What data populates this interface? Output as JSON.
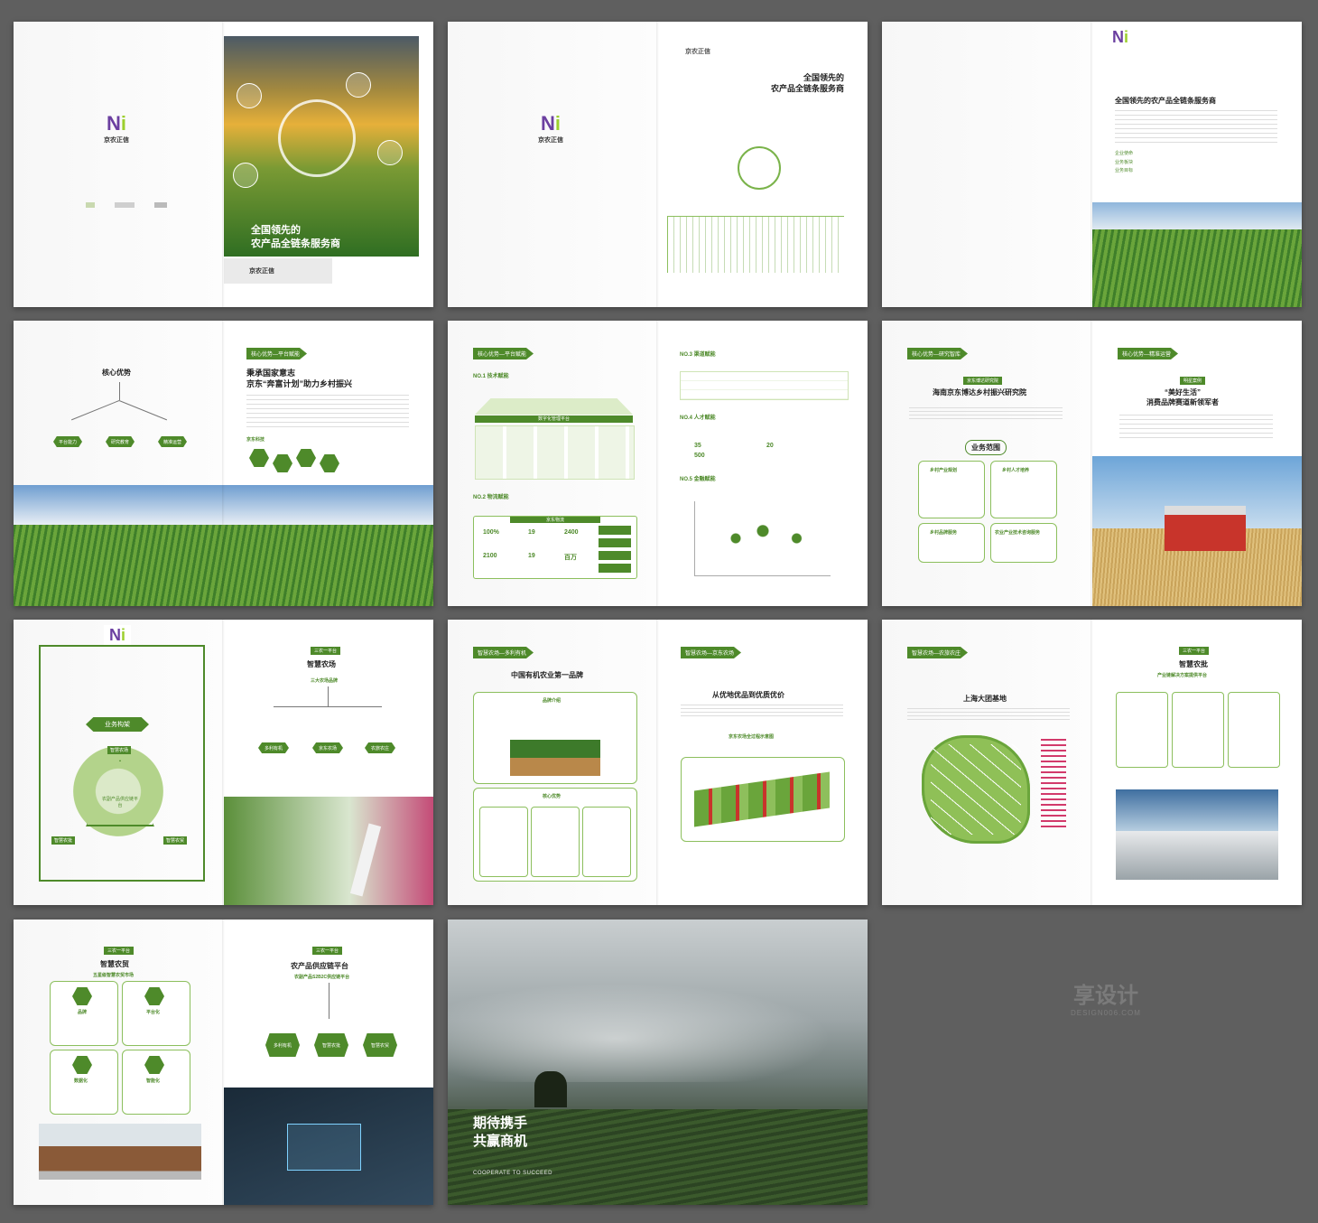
{
  "brand": {
    "name": "京农正信",
    "accent": "#4e8a2a",
    "accent_light": "#9ccf2e",
    "logo_purple": "#6b3fa0"
  },
  "spread1": {
    "cover_title_1": "全国领先的",
    "cover_title_2": "农产品全链条服务商",
    "brand_name": "京农正信"
  },
  "spread2": {
    "title_1": "全国领先的",
    "title_2": "农产品全链条服务商"
  },
  "spread3": {
    "title": "全国领先的农产品全链条服务商",
    "bullets": [
      "企业使命",
      "业务板块",
      "业务目标"
    ]
  },
  "spread4": {
    "left_title": "核心优势",
    "left_items": [
      "平台能力",
      "研究教育",
      "精准运营"
    ],
    "tag": "核心优势—平台赋能",
    "title_1": "秉承国家意志",
    "title_2": "京东“奔富计划”助力乡村振兴",
    "subtag": "京东科技"
  },
  "spread5": {
    "tag": "核心优势—平台赋能",
    "no1": "NO.1 技术赋能",
    "platform": "数字化管理平台",
    "no2": "NO.2 物流赋能",
    "logistics": "京东物流",
    "stats": [
      "100%",
      "19",
      "2400",
      "2100",
      "19",
      "百万"
    ],
    "no3": "NO.3 渠道赋能",
    "no4": "NO.4 人才赋能",
    "no4_stats": [
      "35",
      "20",
      "500"
    ],
    "no5": "NO.5 金融赋能"
  },
  "spread6": {
    "tag_left": "核心优势—研究智库",
    "badge": "京东博达研究院",
    "title": "海南京东博达乡村振兴研究院",
    "scope": "业务范围",
    "boxes": [
      "乡村产业规划",
      "乡村人才培养",
      "乡村品牌服务",
      "农业产业技术咨询服务"
    ],
    "tag_right": "核心优势—精准运营",
    "badge_right": "明星案例",
    "title_right_1": "“美好生活”",
    "title_right_2": "消费品牌赛道新领军者"
  },
  "spread7": {
    "arch_title": "业务构架",
    "nodes": [
      "智慧农场",
      "智慧农批",
      "智慧农贸"
    ],
    "center": "农副产品供应链平台",
    "tag": "三农一平台",
    "title": "智慧农场",
    "subtitle": "三大农场品牌",
    "brands": [
      "多利有机",
      "京东农场",
      "农旅农庄"
    ]
  },
  "spread8": {
    "tag_left": "智慧农场—多利有机",
    "title_left": "中国有机农业第一品牌",
    "box1": "品牌介绍",
    "box2": "核心优势",
    "tag_right": "智慧农场—京东农场",
    "title_right": "从优地优品到优质优价",
    "diagram": "京东农场全过程示意图"
  },
  "spread9": {
    "tag_left": "智慧农场—农旅农庄",
    "title_left": "上海大团基地",
    "tag_right": "三农一平台",
    "title_right": "智慧农批",
    "subtitle_right": "产业链解决方案提供平台"
  },
  "spread10": {
    "tag_left": "三农一平台",
    "title_left": "智慧农贸",
    "subtitle_left": "五星级智慧农贸市场",
    "cells": [
      "品牌",
      "平台化",
      "数据化",
      "智能化"
    ],
    "tag_right": "三农一平台",
    "title_right": "农产品供应链平台",
    "subtitle_right": "农副产品S2B2C供应链平台",
    "hexes": [
      "多利有机",
      "智慧农批",
      "智慧农贸"
    ]
  },
  "spread11": {
    "line1": "期待携手",
    "line2": "共赢商机",
    "en": "COOPERATE TO SUCCEED"
  },
  "watermark": {
    "cn": "享设计",
    "en": "DESIGN006.COM"
  }
}
